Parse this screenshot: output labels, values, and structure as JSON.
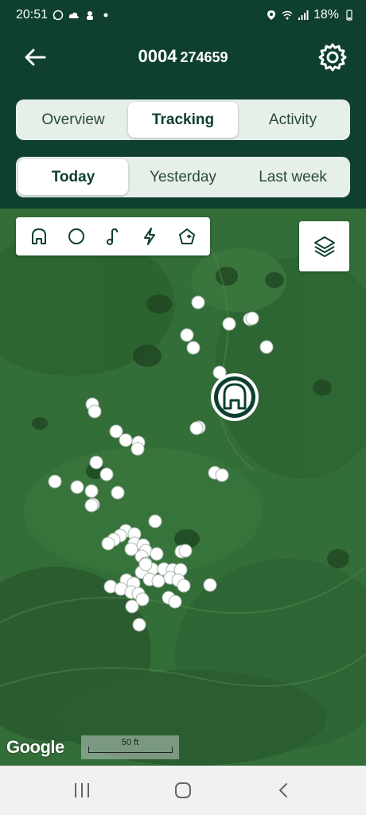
{
  "status_bar": {
    "time": "20:51",
    "battery": "18%",
    "icons_left": [
      "whatsapp-icon",
      "cloud-icon",
      "notification-icon",
      "dot-icon"
    ],
    "icons_right": [
      "location-icon",
      "wifi-icon",
      "signal-icon",
      "battery-icon"
    ]
  },
  "header": {
    "id_main": "0004",
    "id_sub": "274659",
    "back_icon": "arrow-left-icon",
    "settings_icon": "gear-icon"
  },
  "tabs": [
    {
      "label": "Overview",
      "active": false
    },
    {
      "label": "Tracking",
      "active": true
    },
    {
      "label": "Activity",
      "active": false
    }
  ],
  "periods": [
    {
      "label": "Today",
      "active": true
    },
    {
      "label": "Yesterday",
      "active": false
    },
    {
      "label": "Last week",
      "active": false
    }
  ],
  "map": {
    "filters": [
      "base-station-icon",
      "circle-icon",
      "music-note-icon",
      "lightning-icon",
      "home-pentagon-icon"
    ],
    "layers_icon": "layers-icon",
    "attribution": "Google",
    "scale_label": "50 ft",
    "colors": {
      "accent": "#0e3f2f",
      "point": "#ffffff"
    }
  },
  "nav": {
    "icons": [
      "recent-apps-icon",
      "home-icon",
      "back-icon"
    ]
  }
}
